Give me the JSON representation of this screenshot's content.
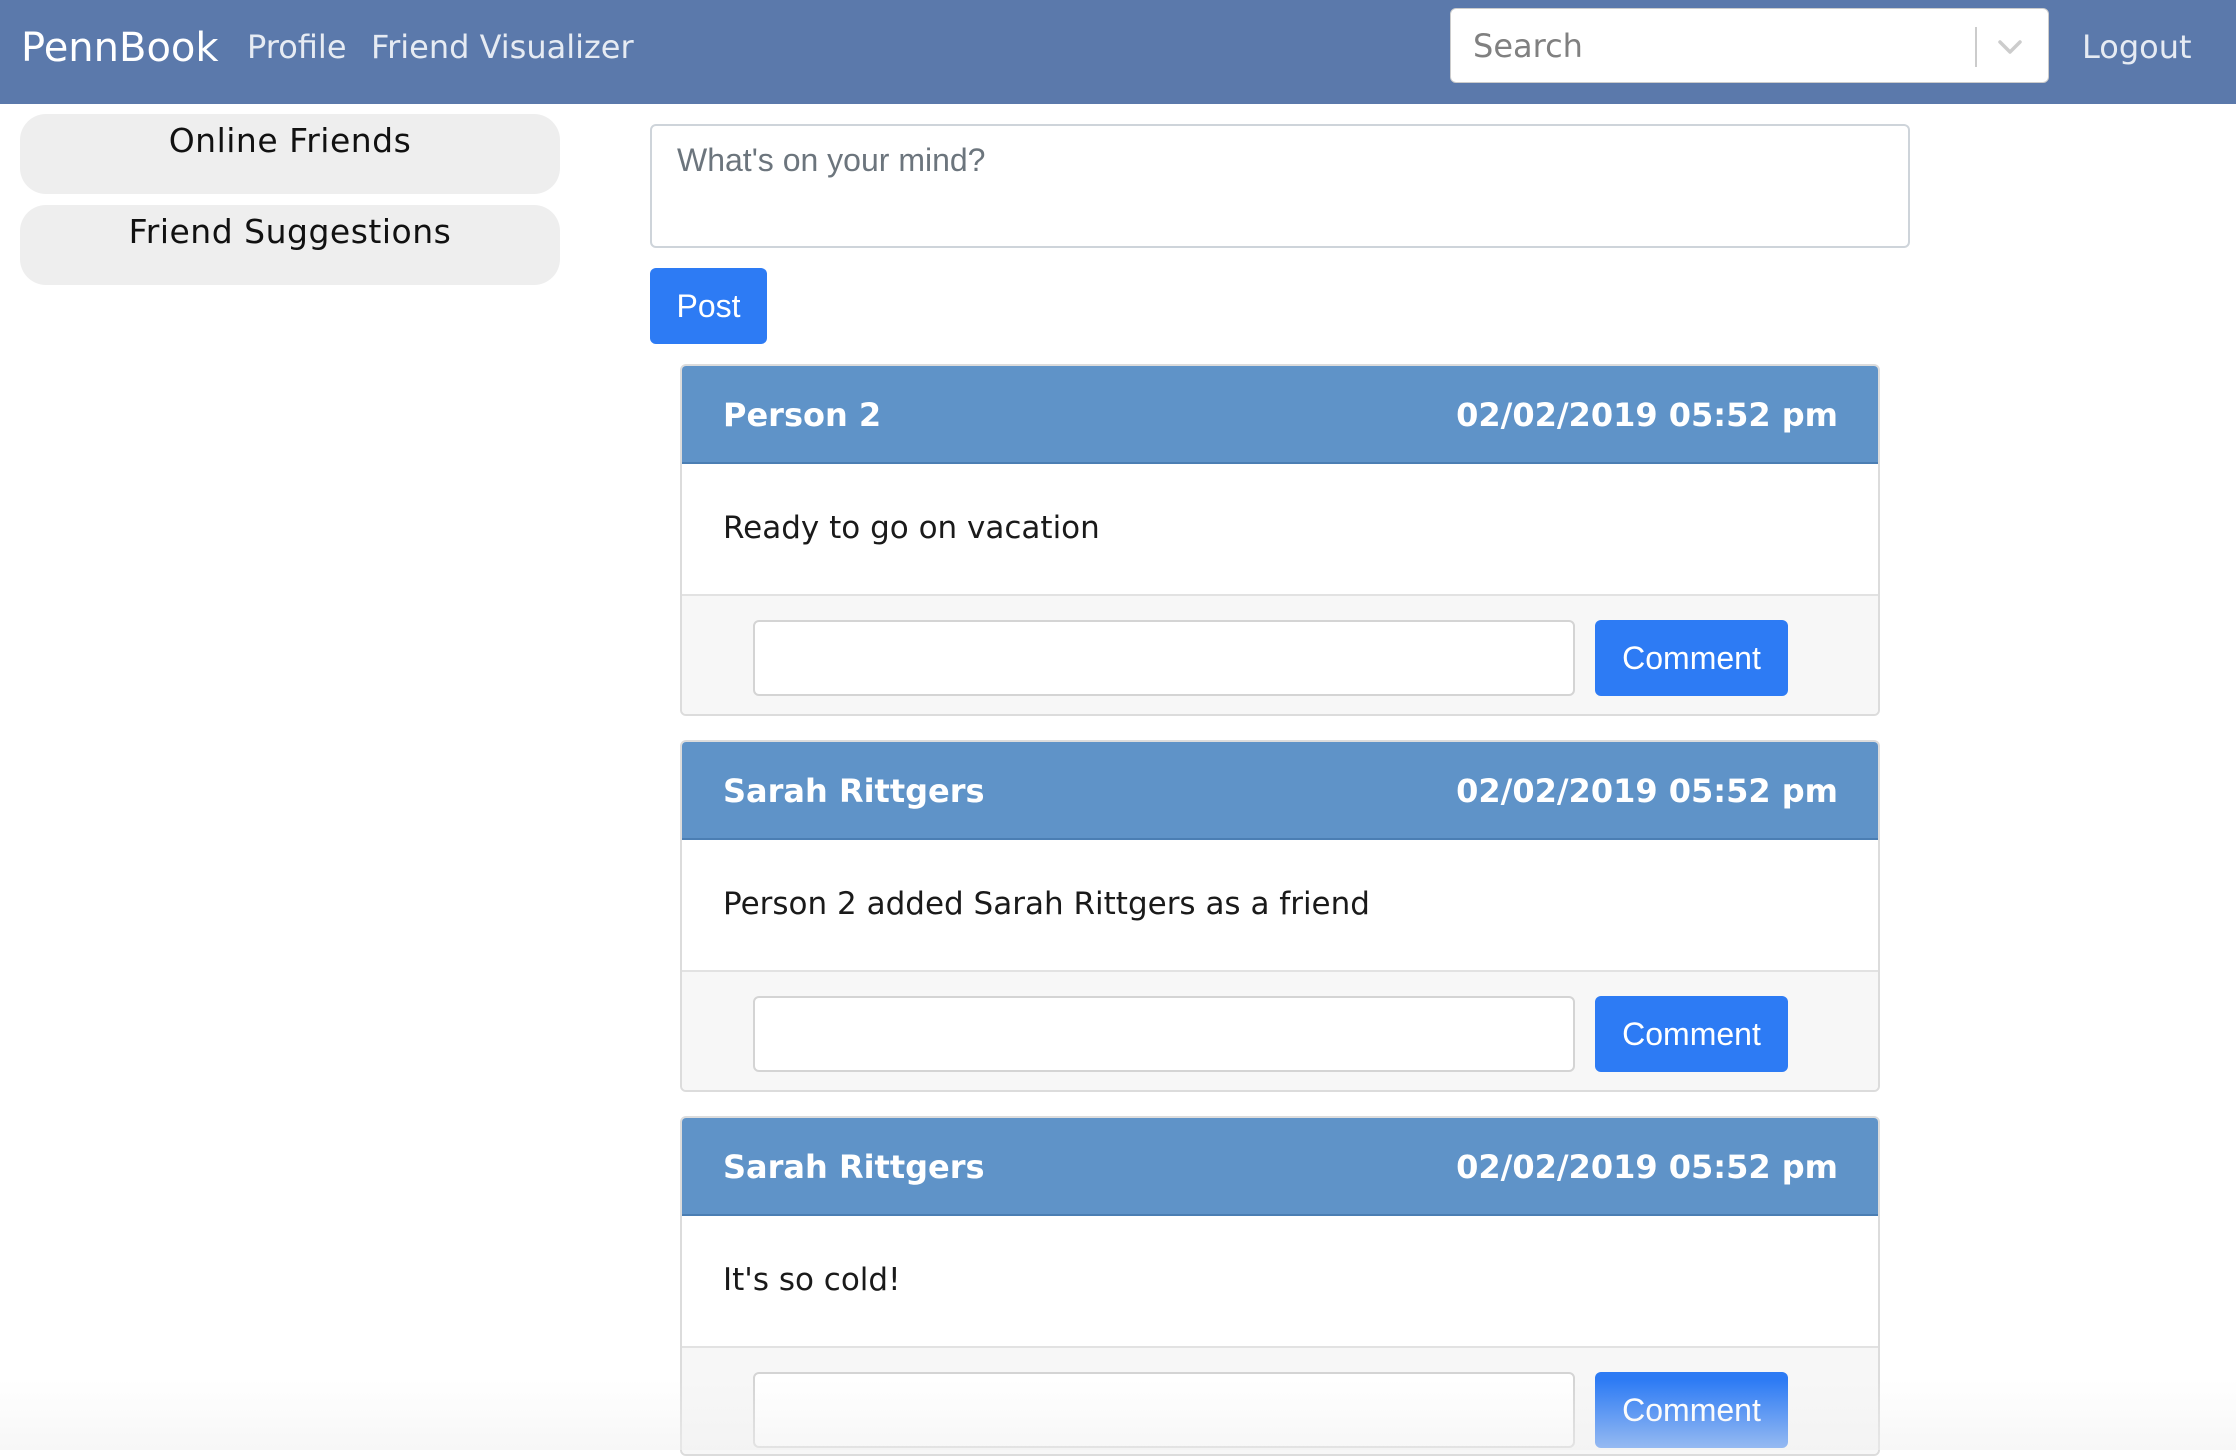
{
  "navbar": {
    "brand": "PennBook",
    "links": [
      "Profile",
      "Friend Visualizer"
    ],
    "logout": "Logout",
    "search": {
      "placeholder": "Search",
      "icon": "chevron-down-icon"
    }
  },
  "sidebar": {
    "items": [
      "Online Friends",
      "Friend Suggestions"
    ]
  },
  "composer": {
    "placeholder": "What's on your mind?",
    "post_label": "Post"
  },
  "posts": [
    {
      "author": "Person 2",
      "timestamp": "02/02/2019 05:52 pm",
      "text": "Ready to go on vacation",
      "comment_label": "Comment"
    },
    {
      "author": "Sarah Rittgers",
      "timestamp": "02/02/2019 05:52 pm",
      "text": "Person 2 added Sarah Rittgers as a friend",
      "comment_label": "Comment"
    },
    {
      "author": "Sarah Rittgers",
      "timestamp": "02/02/2019 05:52 pm",
      "text": "It's so cold!",
      "comment_label": "Comment"
    }
  ],
  "colors": {
    "navbar": "#5b79ab",
    "card_header": "#5f93c8",
    "primary_button": "#2d7bf4"
  }
}
